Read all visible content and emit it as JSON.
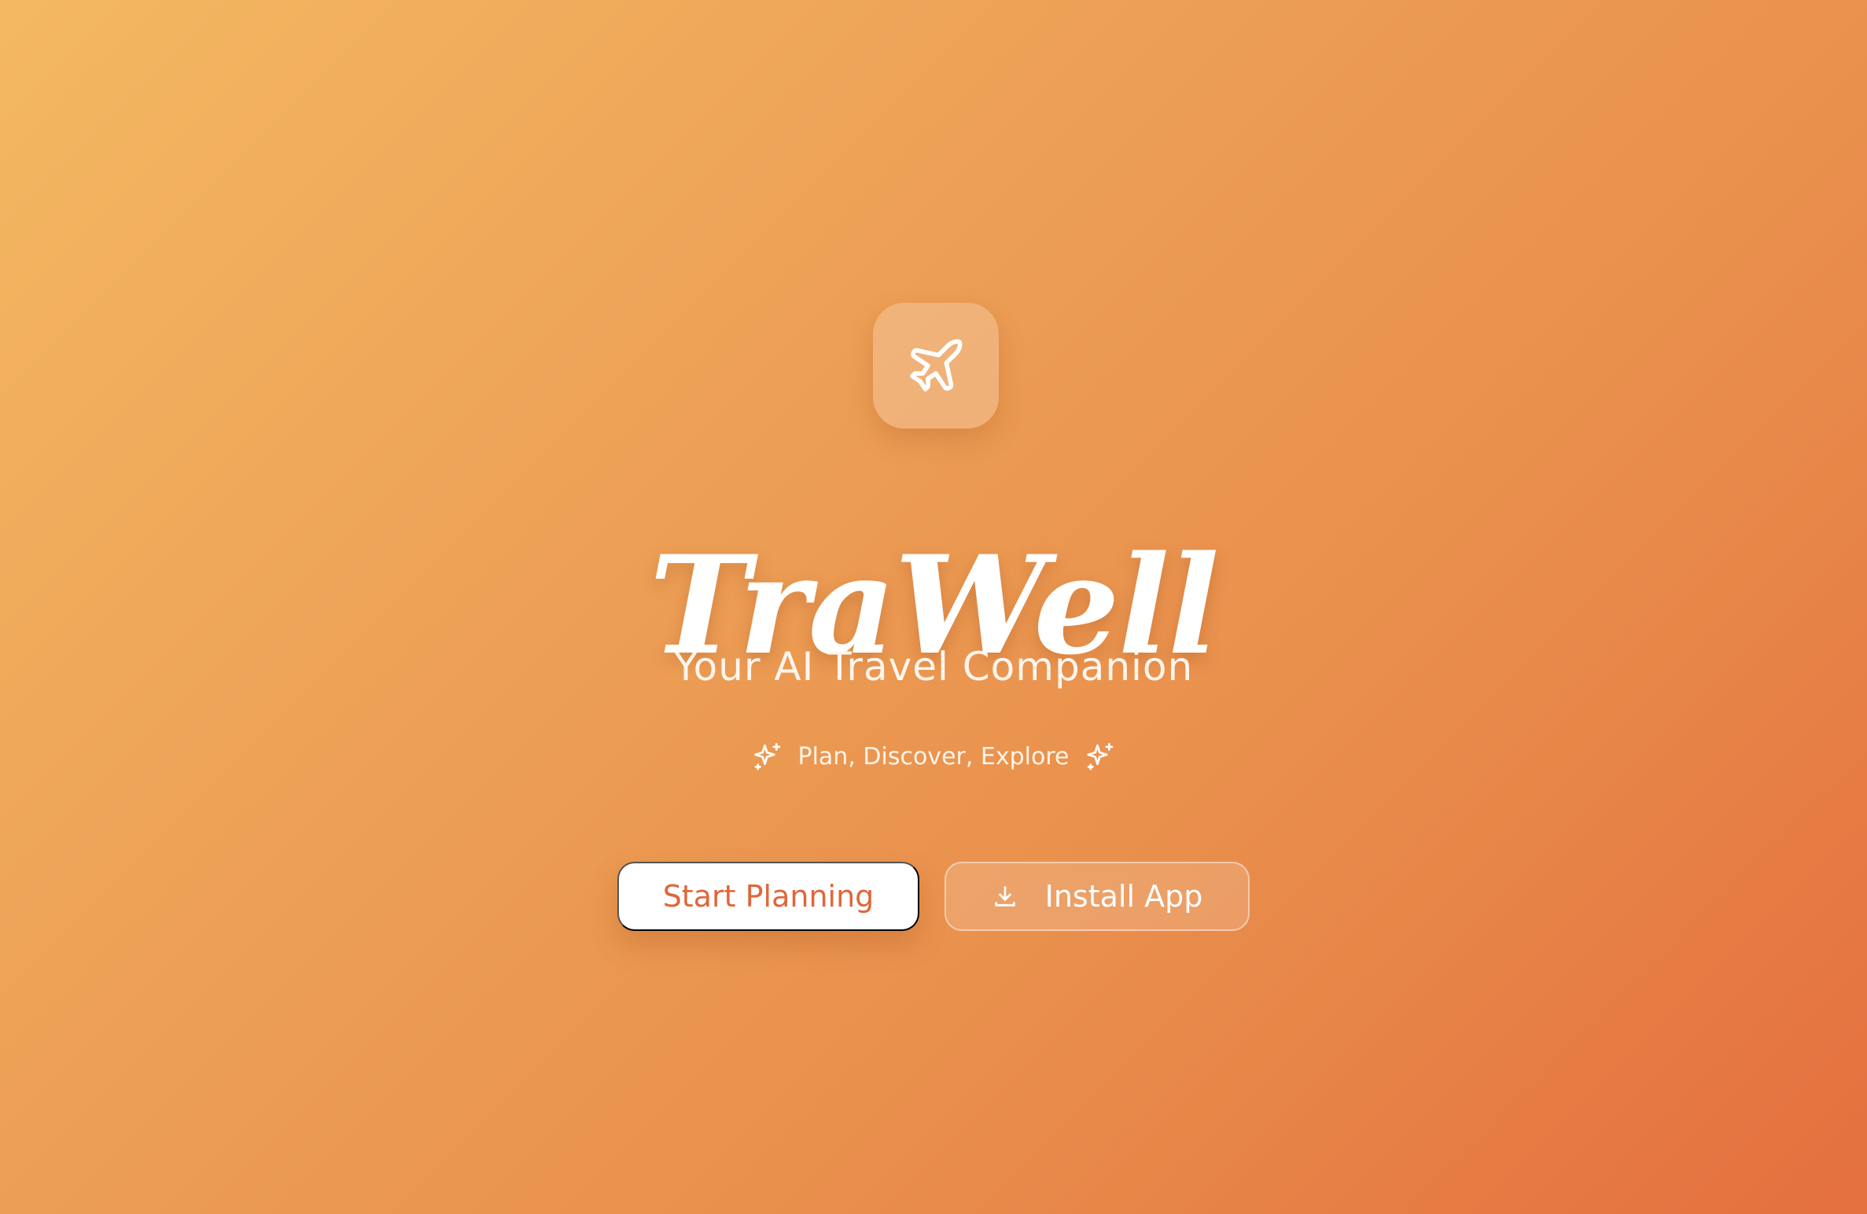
{
  "app": {
    "name": "TraWell",
    "tagline": "Your AI Travel Companion",
    "subline": "Plan, Discover, Explore"
  },
  "icons": {
    "logo": "airplane-icon",
    "sparkle": "sparkles-icon",
    "download": "download-icon"
  },
  "actions": {
    "primary_label": "Start Planning",
    "secondary_label": "Install App"
  },
  "colors": {
    "gradient_start": "#f4b862",
    "gradient_end": "#e46f3f",
    "primary_button_text": "#e0663a",
    "white": "#ffffff"
  }
}
